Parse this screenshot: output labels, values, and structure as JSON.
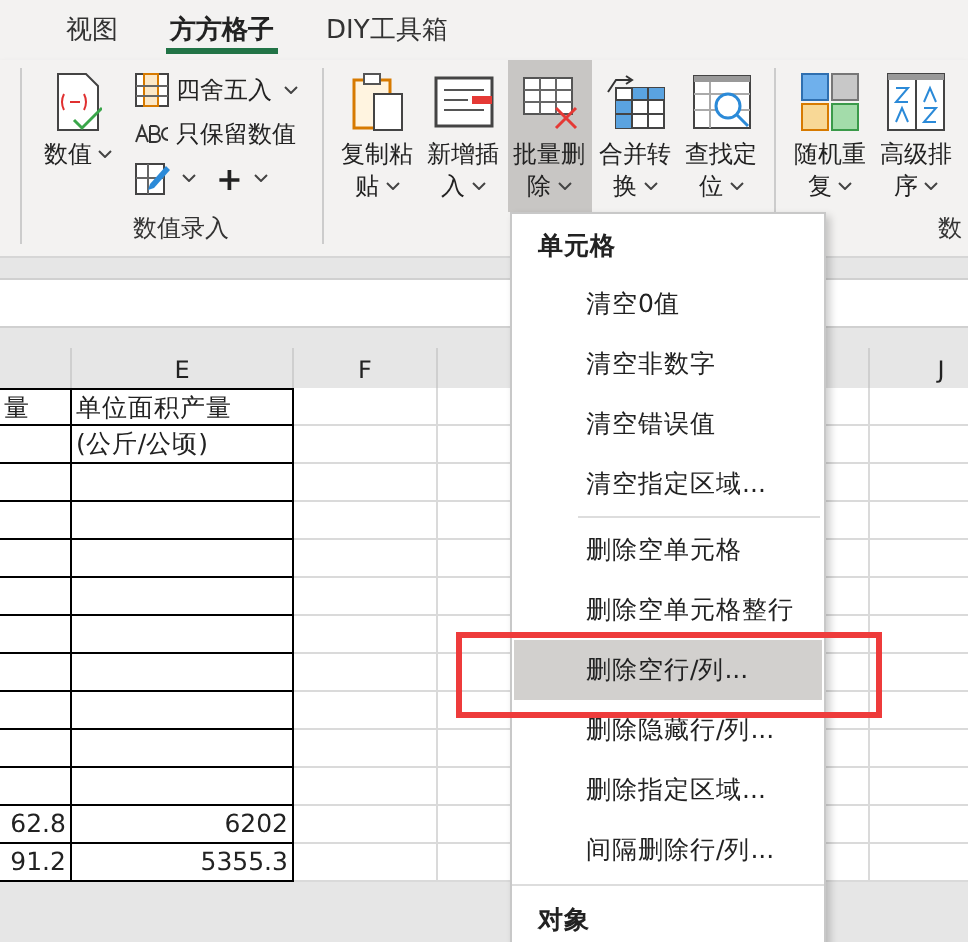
{
  "tabs": [
    {
      "label": "视图",
      "selected": false
    },
    {
      "label": "方方格子",
      "selected": true
    },
    {
      "label": "DIY工具箱",
      "selected": false
    }
  ],
  "ribbon": {
    "groups": [
      {
        "label": "数值录入",
        "big_buttons": [
          {
            "kind": "number",
            "lines": [
              "数值"
            ],
            "dropdown": true,
            "selected": false
          }
        ],
        "small_buttons": [
          {
            "kind": "round",
            "label": "四舍五入",
            "dropdown": true
          },
          {
            "kind": "abc",
            "label": "只保留数值",
            "dropdown": false
          },
          {
            "kind": "edit",
            "dropdown": true
          },
          {
            "kind": "plus",
            "label": "+",
            "dropdown": true
          }
        ]
      },
      {
        "big_buttons": [
          {
            "kind": "paste",
            "lines": [
              "复制粘",
              "贴"
            ],
            "dropdown": true,
            "selected": false
          },
          {
            "kind": "insert",
            "lines": [
              "新增插",
              "入"
            ],
            "dropdown": true,
            "selected": false
          },
          {
            "kind": "delete",
            "lines": [
              "批量删",
              "除"
            ],
            "dropdown": true,
            "selected": true
          },
          {
            "kind": "merge",
            "lines": [
              "合并转",
              "换"
            ],
            "dropdown": true,
            "selected": false
          },
          {
            "kind": "find",
            "lines": [
              "查找定",
              "位"
            ],
            "dropdown": true,
            "selected": false
          }
        ]
      },
      {
        "label": "数",
        "big_buttons": [
          {
            "kind": "random",
            "lines": [
              "随机重",
              "复"
            ],
            "dropdown": true,
            "selected": false
          },
          {
            "kind": "sort",
            "lines": [
              "高级排",
              "序"
            ],
            "dropdown": true,
            "selected": false
          }
        ]
      }
    ]
  },
  "sheet": {
    "columns": [
      "",
      "E",
      "F",
      "",
      "",
      "",
      "J"
    ],
    "header_rows": [
      [
        "量",
        "单位面积产量"
      ],
      [
        "",
        "(公斤/公顷)"
      ]
    ],
    "rows": [
      [
        "",
        ""
      ],
      [
        "",
        ""
      ],
      [
        "",
        ""
      ],
      [
        "",
        ""
      ],
      [
        "",
        ""
      ],
      [
        "",
        ""
      ],
      [
        "",
        ""
      ],
      [
        "",
        ""
      ],
      [
        "",
        ""
      ],
      [
        "62.8",
        "6202"
      ],
      [
        "91.2",
        "5355.3"
      ]
    ]
  },
  "menu": {
    "sections": [
      {
        "title": "单元格",
        "groups": [
          [
            {
              "label": "清空0值",
              "selected": false
            },
            {
              "label": "清空非数字",
              "selected": false
            },
            {
              "label": "清空错误值",
              "selected": false
            },
            {
              "label": "清空指定区域...",
              "selected": false
            }
          ],
          [
            {
              "label": "删除空单元格",
              "selected": false
            },
            {
              "label": "删除空单元格整行",
              "selected": false
            },
            {
              "label": "删除空行/列...",
              "selected": true
            },
            {
              "label": "删除隐藏行/列...",
              "selected": false
            },
            {
              "label": "删除指定区域...",
              "selected": false
            },
            {
              "label": "间隔删除行/列...",
              "selected": false
            }
          ]
        ]
      },
      {
        "title": "对象"
      }
    ],
    "highlighted_item": true
  }
}
